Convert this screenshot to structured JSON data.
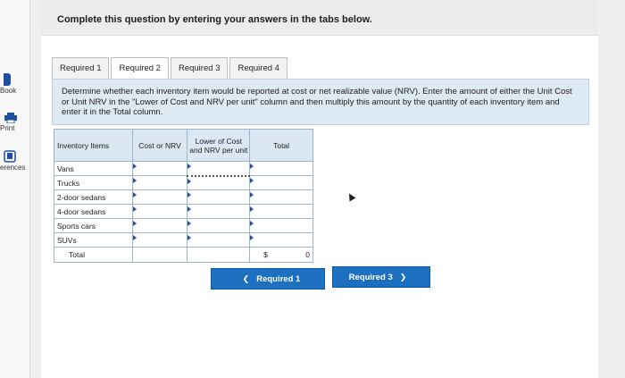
{
  "sidebar": {
    "ebook_label": "Book",
    "print_label": "Print",
    "references_label": "erences"
  },
  "instruction": "Complete this question by entering your answers in the tabs below.",
  "tabs": [
    {
      "label": "Required 1"
    },
    {
      "label": "Required 2"
    },
    {
      "label": "Required 3"
    },
    {
      "label": "Required 4"
    }
  ],
  "directions": "Determine whether each inventory item would be reported at cost or net realizable value (NRV). Enter the amount of either the Unit Cost or Unit NRV in the \"Lower of Cost and NRV per unit\" column and then multiply this amount by the quantity of each inventory item and enter it in the Total column.",
  "table": {
    "headers": [
      "Inventory Items",
      "Cost or NRV",
      "Lower of Cost and NRV per unit",
      "Total"
    ],
    "rows": [
      "Vans",
      "Trucks",
      "2-door sedans",
      "4-door sedans",
      "Sports cars",
      "SUVs"
    ],
    "total_label": "Total",
    "total_currency": "$",
    "total_value": "0"
  },
  "nav": {
    "prev_label": "Required 1",
    "next_label": "Required 3"
  },
  "colors": {
    "accent": "#1d6fbf",
    "table_header": "#dbe7f2",
    "directions_bg": "#dde9f3"
  }
}
